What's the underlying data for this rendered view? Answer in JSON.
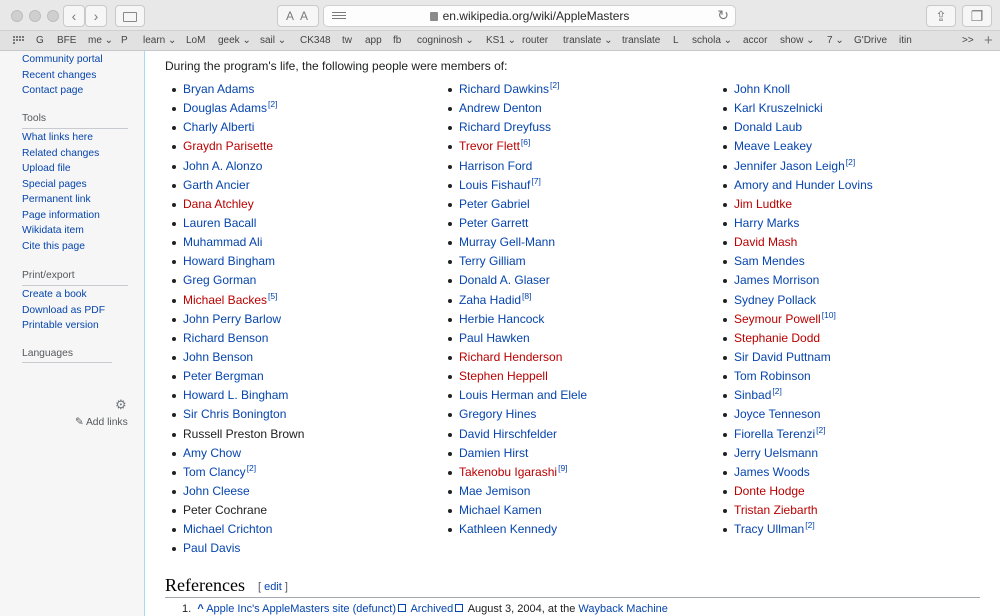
{
  "browser": {
    "url": "en.wikipedia.org/wiki/AppleMasters",
    "reader_label": "AA",
    "favorites": [
      "G",
      "BFE",
      "me ⌄",
      "P",
      "learn ⌄",
      "LoM",
      "geek ⌄",
      "sail ⌄",
      "CK348",
      "tw",
      "app",
      "fb",
      "cogninosh ⌄",
      "KS1 ⌄",
      "router",
      "translate ⌄",
      "translate",
      "L",
      "schola ⌄",
      "accor",
      "show ⌄",
      "7 ⌄",
      "G'Drive",
      "itin"
    ],
    "overflow": ">>",
    "add": "+"
  },
  "sidebar": {
    "top_links": [
      "Community portal",
      "Recent changes",
      "Contact page"
    ],
    "tools_heading": "Tools",
    "tools": [
      "What links here",
      "Related changes",
      "Upload file",
      "Special pages",
      "Permanent link",
      "Page information",
      "Wikidata item",
      "Cite this page"
    ],
    "print_heading": "Print/export",
    "print": [
      "Create a book",
      "Download as PDF",
      "Printable version"
    ],
    "languages_heading": "Languages",
    "add_links": "Add links"
  },
  "content": {
    "intro": "During the program's life, the following people were members of:",
    "columns": [
      [
        {
          "name": "Bryan Adams",
          "color": "blue"
        },
        {
          "name": "Douglas Adams",
          "color": "blue",
          "ref": "[2]"
        },
        {
          "name": "Charly Alberti",
          "color": "blue"
        },
        {
          "name": "Graydn Parisette",
          "color": "red"
        },
        {
          "name": "John A. Alonzo",
          "color": "blue"
        },
        {
          "name": "Garth Ancier",
          "color": "blue"
        },
        {
          "name": "Dana Atchley",
          "color": "red"
        },
        {
          "name": "Lauren Bacall",
          "color": "blue"
        },
        {
          "name": "Muhammad Ali",
          "color": "blue"
        },
        {
          "name": "Howard Bingham",
          "color": "blue"
        },
        {
          "name": "Greg Gorman",
          "color": "blue"
        },
        {
          "name": "Michael Backes",
          "color": "red",
          "ref": "[5]"
        },
        {
          "name": "John Perry Barlow",
          "color": "blue"
        },
        {
          "name": "Richard Benson",
          "color": "blue"
        },
        {
          "name": "John Benson",
          "color": "blue"
        },
        {
          "name": "Peter Bergman",
          "color": "blue"
        },
        {
          "name": "Howard L. Bingham",
          "color": "blue"
        },
        {
          "name": "Sir Chris Bonington",
          "color": "blue"
        },
        {
          "name": "Russell Preston Brown",
          "color": "black"
        },
        {
          "name": "Amy Chow",
          "color": "blue"
        },
        {
          "name": "Tom Clancy",
          "color": "blue",
          "ref": "[2]"
        },
        {
          "name": "John Cleese",
          "color": "blue"
        },
        {
          "name": "Peter Cochrane",
          "color": "black"
        },
        {
          "name": "Michael Crichton",
          "color": "blue"
        },
        {
          "name": "Paul Davis",
          "color": "blue"
        }
      ],
      [
        {
          "name": "Richard Dawkins",
          "color": "blue",
          "ref": "[2]"
        },
        {
          "name": "Andrew Denton",
          "color": "blue"
        },
        {
          "name": "Richard Dreyfuss",
          "color": "blue"
        },
        {
          "name": "Trevor Flett",
          "color": "red",
          "ref": "[6]"
        },
        {
          "name": "Harrison Ford",
          "color": "blue"
        },
        {
          "name": "Louis Fishauf",
          "color": "blue",
          "ref": "[7]"
        },
        {
          "name": "Peter Gabriel",
          "color": "blue"
        },
        {
          "name": "Peter Garrett",
          "color": "blue"
        },
        {
          "name": "Murray Gell-Mann",
          "color": "blue"
        },
        {
          "name": "Terry Gilliam",
          "color": "blue"
        },
        {
          "name": "Donald A. Glaser",
          "color": "blue"
        },
        {
          "name": "Zaha Hadid",
          "color": "blue",
          "ref": "[8]"
        },
        {
          "name": "Herbie Hancock",
          "color": "blue"
        },
        {
          "name": "Paul Hawken",
          "color": "blue"
        },
        {
          "name": "Richard Henderson",
          "color": "red"
        },
        {
          "name": "Stephen Heppell",
          "color": "red"
        },
        {
          "name": "Louis Herman and Elele",
          "color": "blue"
        },
        {
          "name": "Gregory Hines",
          "color": "blue"
        },
        {
          "name": "David Hirschfelder",
          "color": "blue"
        },
        {
          "name": "Damien Hirst",
          "color": "blue"
        },
        {
          "name": "Takenobu Igarashi",
          "color": "red",
          "ref": "[9]"
        },
        {
          "name": "Mae Jemison",
          "color": "blue"
        },
        {
          "name": "Michael Kamen",
          "color": "blue"
        },
        {
          "name": "Kathleen Kennedy",
          "color": "blue"
        }
      ],
      [
        {
          "name": "John Knoll",
          "color": "blue"
        },
        {
          "name": "Karl Kruszelnicki",
          "color": "blue"
        },
        {
          "name": "Donald Laub",
          "color": "blue"
        },
        {
          "name": "Meave Leakey",
          "color": "blue"
        },
        {
          "name": "Jennifer Jason Leigh",
          "color": "blue",
          "ref": "[2]"
        },
        {
          "name": "Amory and Hunder Lovins",
          "color": "blue"
        },
        {
          "name": "Jim Ludtke",
          "color": "red"
        },
        {
          "name": "Harry Marks",
          "color": "blue"
        },
        {
          "name": "David Mash",
          "color": "red"
        },
        {
          "name": "Sam Mendes",
          "color": "blue"
        },
        {
          "name": "James Morrison",
          "color": "blue"
        },
        {
          "name": "Sydney Pollack",
          "color": "blue"
        },
        {
          "name": "Seymour Powell",
          "color": "red",
          "ref": "[10]"
        },
        {
          "name": "Stephanie Dodd",
          "color": "red"
        },
        {
          "name": "Sir David Puttnam",
          "color": "blue"
        },
        {
          "name": "Tom Robinson",
          "color": "blue"
        },
        {
          "name": "Sinbad",
          "color": "blue",
          "ref": "[2]"
        },
        {
          "name": "Joyce Tenneson",
          "color": "blue"
        },
        {
          "name": "Fiorella Terenzi",
          "color": "blue",
          "ref": "[2]"
        },
        {
          "name": "Jerry Uelsmann",
          "color": "blue"
        },
        {
          "name": "James Woods",
          "color": "blue"
        },
        {
          "name": "Donte Hodge",
          "color": "red"
        },
        {
          "name": "Tristan Ziebarth",
          "color": "red"
        },
        {
          "name": "Tracy Ullman",
          "color": "blue",
          "ref": "[2]"
        }
      ]
    ],
    "references_heading": "References",
    "edit_label": "edit",
    "reference_1": {
      "number": "1.",
      "caret": "^",
      "link": "Apple Inc's AppleMasters site (defunct)",
      "archived": "Archived",
      "text": "August 3, 2004, at the",
      "wayback": "Wayback Machine"
    }
  },
  "colors": {
    "link_blue": "#0645ad",
    "redlink": "#ba0000",
    "sidebar_bg": "#f6f6f6"
  }
}
